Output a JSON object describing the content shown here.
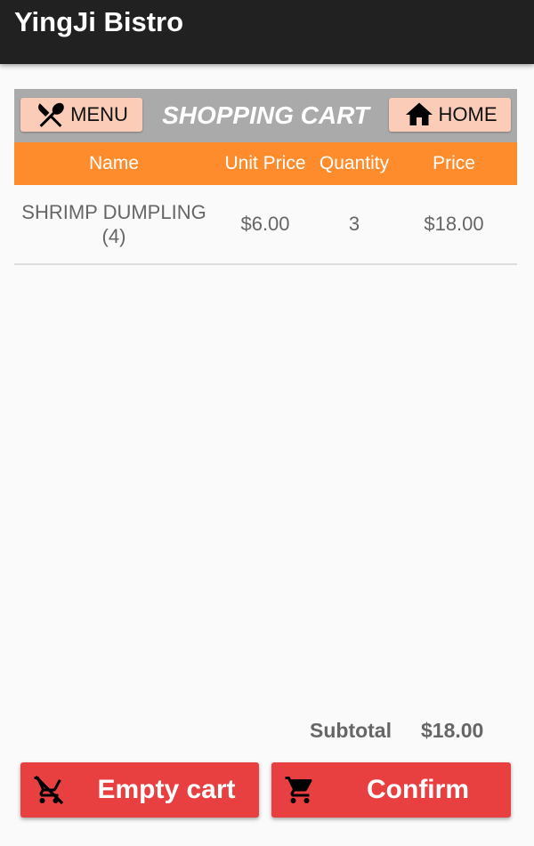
{
  "app": {
    "title": "YingJi Bistro"
  },
  "nav": {
    "menu_label": "MENU",
    "title": "SHOPPING CART",
    "home_label": "HOME"
  },
  "table": {
    "headers": [
      "Name",
      "Unit Price",
      "Quantity",
      "Price"
    ],
    "rows": [
      {
        "name": "SHRIMP DUMPLING (4)",
        "unit_price": "$6.00",
        "quantity": "3",
        "price": "$18.00"
      }
    ]
  },
  "summary": {
    "subtotal_label": "Subtotal",
    "subtotal_value": "$18.00"
  },
  "actions": {
    "empty_label": "Empty cart",
    "confirm_label": "Confirm"
  },
  "colors": {
    "appbar": "#212121",
    "nav_bar": "#aaaaaa",
    "nav_button": "#fbcdb8",
    "table_header": "#ff8c2c",
    "action_button": "#e84040"
  },
  "icons": {
    "menu": "utensils-icon",
    "home": "home-icon",
    "empty": "remove-cart-icon",
    "confirm": "cart-icon"
  }
}
